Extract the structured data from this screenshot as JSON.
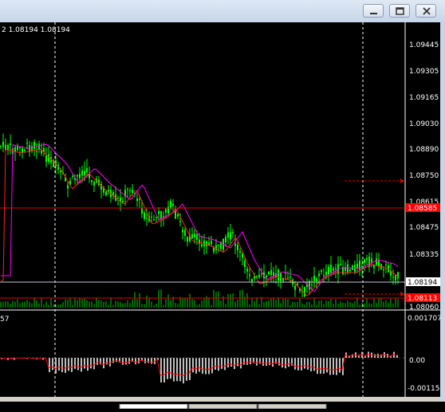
{
  "window": {
    "minimize_icon": "minimize-icon",
    "restore_icon": "restore-icon",
    "close_icon": "close-icon"
  },
  "chart_info": "2 1.08194 1.08194",
  "price_axis": {
    "ticks": [
      "1.09445",
      "1.09305",
      "1.09165",
      "1.09030",
      "1.08890",
      "1.08750",
      "1.08615",
      "1.08475",
      "1.08335",
      "1.08194",
      "1.08060"
    ],
    "hidden_tick": "1.08615",
    "current_price": "1.08194",
    "red_level_1": "1.08585",
    "red_level_2": "1.08113"
  },
  "indicator": {
    "label": "57",
    "ticks": [
      "0.001707",
      "0.00",
      "-0.00115"
    ]
  },
  "colors": {
    "background": "#000000",
    "candle": "#00ff00",
    "ma_fast": "#ff2020",
    "ma_slow": "#ff00ff",
    "level_line": "#e00000",
    "current_line": "#c8c8d8",
    "histogram": "#c0c0c0",
    "signal": "#ff0000",
    "axis_text": "#ffffff",
    "label_bg_red": "#ff0000"
  }
}
